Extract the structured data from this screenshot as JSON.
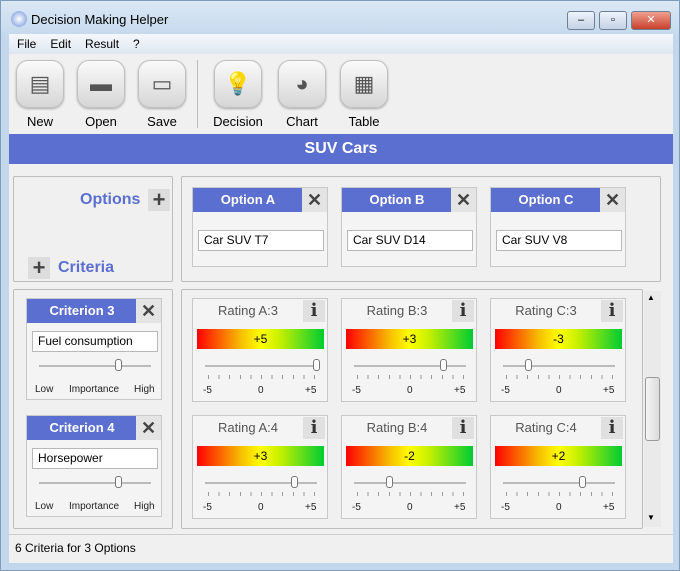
{
  "window": {
    "title": "Decision Making Helper",
    "min": "–",
    "max": "▫",
    "close": "✕"
  },
  "menu": [
    "File",
    "Edit",
    "Result",
    "?"
  ],
  "toolbar": [
    {
      "label": "New",
      "icon": "▤"
    },
    {
      "label": "Open",
      "icon": "▬"
    },
    {
      "label": "Save",
      "icon": "▭"
    },
    {
      "label": "Decision",
      "icon": "💡"
    },
    {
      "label": "Chart",
      "icon": "◕"
    },
    {
      "label": "Table",
      "icon": "▦"
    }
  ],
  "banner": "SUV Cars",
  "options_label": "Options",
  "criteria_label": "Criteria",
  "plus": "+",
  "remove": "✕",
  "info": "i",
  "options": [
    {
      "name": "Option A",
      "value": "Car SUV T7"
    },
    {
      "name": "Option B",
      "value": "Car SUV D14"
    },
    {
      "name": "Option C",
      "value": "Car SUV V8"
    }
  ],
  "criteria": [
    {
      "name": "Criterion 3",
      "value": "Fuel consumption",
      "importance": 0.7
    },
    {
      "name": "Criterion 4",
      "value": "Horsepower",
      "importance": 0.7
    }
  ],
  "importance_labels": {
    "low": "Low",
    "mid": "Importance",
    "high": "High"
  },
  "rating_scale": {
    "min": "-5",
    "mid": "0",
    "max": "+5"
  },
  "ratings": [
    [
      {
        "label": "Rating A:3",
        "value": "+5",
        "num": 5
      },
      {
        "label": "Rating B:3",
        "value": "+3",
        "num": 3
      },
      {
        "label": "Rating C:3",
        "value": "-3",
        "num": -3
      }
    ],
    [
      {
        "label": "Rating A:4",
        "value": "+3",
        "num": 3
      },
      {
        "label": "Rating B:4",
        "value": "-2",
        "num": -2
      },
      {
        "label": "Rating C:4",
        "value": "+2",
        "num": 2
      }
    ]
  ],
  "status": "6 Criteria for 3 Options"
}
